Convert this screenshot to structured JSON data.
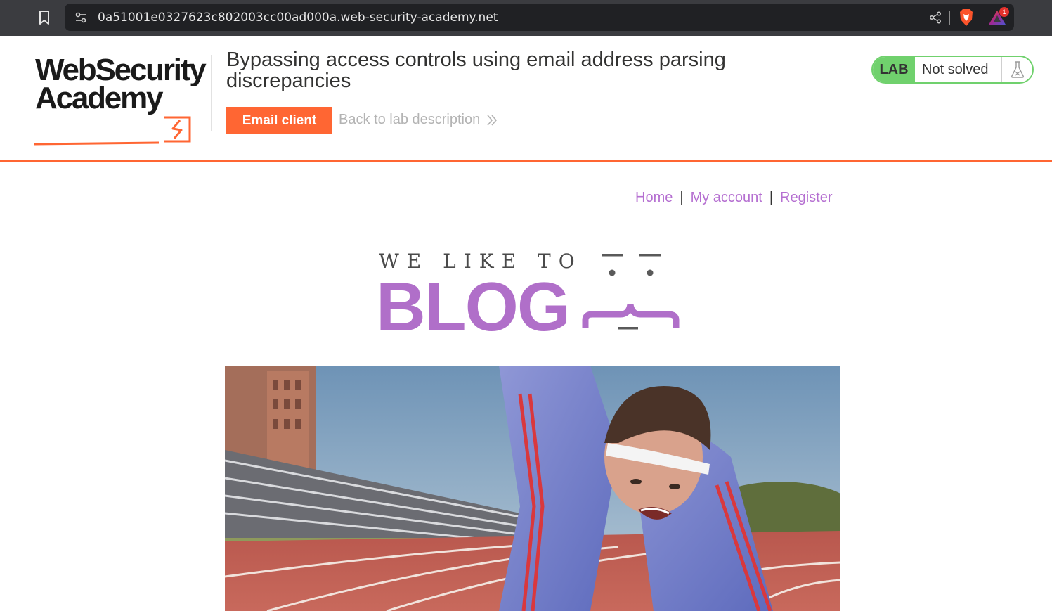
{
  "browser": {
    "url": "0a51001e0327623c802003cc00ad000a.web-security-academy.net",
    "notification_count": "1"
  },
  "academy": {
    "logo_line1": "WebSecurity",
    "logo_line2": "Academy",
    "lab_title": "Bypassing access controls using email address parsing discrepancies",
    "email_client_label": "Email client",
    "back_link_label": "Back to lab description",
    "lab_tag": "LAB",
    "lab_status": "Not solved"
  },
  "blog": {
    "nav": {
      "home": "Home",
      "my_account": "My account",
      "register": "Register",
      "separator": "|"
    },
    "banner_small": "WE LIKE TO",
    "banner_big": "BLOG"
  },
  "colors": {
    "accent_orange": "#ff6633",
    "lab_green": "#70d16d",
    "link_purple": "#b56fd1",
    "banner_purple": "#b06fc9"
  }
}
